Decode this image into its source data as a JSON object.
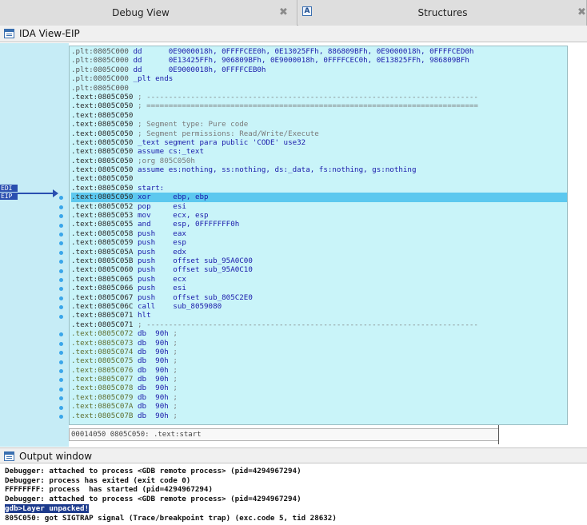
{
  "tabs": [
    {
      "label": "Debug View"
    },
    {
      "label": "Structures"
    }
  ],
  "tab_struct_icon": "A",
  "ida_view": {
    "title": "IDA View-EIP"
  },
  "registers": [
    {
      "name": "EDI"
    },
    {
      "name": "EIP"
    }
  ],
  "listing": [
    {
      "addr": ".plt:0805C000",
      "seg": "plt",
      "mnem": "dd",
      "ops": "0E9000018h, 0FFFFCEE0h, 0E13025FFh, 886809BFh, 0E9000018h, 0FFFFCED0h",
      "cmt": ""
    },
    {
      "addr": ".plt:0805C000",
      "seg": "plt",
      "mnem": "dd",
      "ops": "0E13425FFh, 906809BFh, 0E9000018h, 0FFFFCEC0h, 0E13825FFh, 986809BFh",
      "cmt": ""
    },
    {
      "addr": ".plt:0805C000",
      "seg": "plt",
      "mnem": "dd",
      "ops": "0E9000018h, 0FFFFCEB0h",
      "cmt": ""
    },
    {
      "addr": ".plt:0805C000",
      "seg": "plt",
      "mnem": "_plt ends",
      "ops": "",
      "cmt": ""
    },
    {
      "addr": ".plt:0805C000",
      "seg": "plt",
      "mnem": "",
      "ops": "",
      "cmt": ""
    },
    {
      "addr": ".text:0805C050",
      "seg": "text",
      "mnem": "",
      "ops": "",
      "cmt": "; ---------------------------------------------------------------------------"
    },
    {
      "addr": ".text:0805C050",
      "seg": "text",
      "mnem": "",
      "ops": "",
      "cmt": "; ==========================================================================="
    },
    {
      "addr": ".text:0805C050",
      "seg": "text",
      "mnem": "",
      "ops": "",
      "cmt": ""
    },
    {
      "addr": ".text:0805C050",
      "seg": "text",
      "mnem": "",
      "ops": "",
      "cmt": "; Segment type: Pure code"
    },
    {
      "addr": ".text:0805C050",
      "seg": "text",
      "mnem": "",
      "ops": "",
      "cmt": "; Segment permissions: Read/Write/Execute"
    },
    {
      "addr": ".text:0805C050",
      "seg": "text",
      "mnem": "_text segment para public 'CODE' use32",
      "ops": "",
      "cmt": ""
    },
    {
      "addr": ".text:0805C050",
      "seg": "text",
      "mnem": "assume cs:_text",
      "ops": "",
      "cmt": ""
    },
    {
      "addr": ".text:0805C050",
      "seg": "text",
      "mnem": "",
      "ops": "",
      "cmt": ";org 805C050h"
    },
    {
      "addr": ".text:0805C050",
      "seg": "text",
      "mnem": "assume es:nothing, ss:nothing, ds:_data, fs:nothing, gs:nothing",
      "ops": "",
      "cmt": ""
    },
    {
      "addr": ".text:0805C050",
      "seg": "text",
      "mnem": "",
      "ops": "",
      "cmt": ""
    },
    {
      "addr": ".text:0805C050",
      "seg": "text",
      "mnem": "start:",
      "ops": "",
      "cmt": ""
    },
    {
      "addr": ".text:0805C050",
      "seg": "text",
      "mnem": "xor",
      "ops": "ebp, ebp",
      "cmt": "",
      "highlight": true
    },
    {
      "addr": ".text:0805C052",
      "seg": "text",
      "mnem": "pop",
      "ops": "esi",
      "cmt": ""
    },
    {
      "addr": ".text:0805C053",
      "seg": "text",
      "mnem": "mov",
      "ops": "ecx, esp",
      "cmt": ""
    },
    {
      "addr": ".text:0805C055",
      "seg": "text",
      "mnem": "and",
      "ops": "esp, 0FFFFFFF0h",
      "cmt": ""
    },
    {
      "addr": ".text:0805C058",
      "seg": "text",
      "mnem": "push",
      "ops": "eax",
      "cmt": ""
    },
    {
      "addr": ".text:0805C059",
      "seg": "text",
      "mnem": "push",
      "ops": "esp",
      "cmt": ""
    },
    {
      "addr": ".text:0805C05A",
      "seg": "text",
      "mnem": "push",
      "ops": "edx",
      "cmt": ""
    },
    {
      "addr": ".text:0805C05B",
      "seg": "text",
      "mnem": "push",
      "ops": "offset sub_95A0C00",
      "cmt": ""
    },
    {
      "addr": ".text:0805C060",
      "seg": "text",
      "mnem": "push",
      "ops": "offset sub_95A0C10",
      "cmt": ""
    },
    {
      "addr": ".text:0805C065",
      "seg": "text",
      "mnem": "push",
      "ops": "ecx",
      "cmt": ""
    },
    {
      "addr": ".text:0805C066",
      "seg": "text",
      "mnem": "push",
      "ops": "esi",
      "cmt": ""
    },
    {
      "addr": ".text:0805C067",
      "seg": "text",
      "mnem": "push",
      "ops": "offset sub_805C2E0",
      "cmt": ""
    },
    {
      "addr": ".text:0805C06C",
      "seg": "text",
      "mnem": "call",
      "ops": "sub_8059080",
      "cmt": ""
    },
    {
      "addr": ".text:0805C071",
      "seg": "text",
      "mnem": "hlt",
      "ops": "",
      "cmt": ""
    },
    {
      "addr": ".text:0805C071",
      "seg": "text",
      "mnem": "",
      "ops": "",
      "cmt": "; ---------------------------------------------------------------------------"
    },
    {
      "addr": ".text:0805C072",
      "seg": "data",
      "mnem": "db",
      "ops": "90h",
      "cmt": ";"
    },
    {
      "addr": ".text:0805C073",
      "seg": "data",
      "mnem": "db",
      "ops": "90h",
      "cmt": ";"
    },
    {
      "addr": ".text:0805C074",
      "seg": "data",
      "mnem": "db",
      "ops": "90h",
      "cmt": ";"
    },
    {
      "addr": ".text:0805C075",
      "seg": "data",
      "mnem": "db",
      "ops": "90h",
      "cmt": ";"
    },
    {
      "addr": ".text:0805C076",
      "seg": "data",
      "mnem": "db",
      "ops": "90h",
      "cmt": ";"
    },
    {
      "addr": ".text:0805C077",
      "seg": "data",
      "mnem": "db",
      "ops": "90h",
      "cmt": ";"
    },
    {
      "addr": ".text:0805C078",
      "seg": "data",
      "mnem": "db",
      "ops": "90h",
      "cmt": ";"
    },
    {
      "addr": ".text:0805C079",
      "seg": "data",
      "mnem": "db",
      "ops": "90h",
      "cmt": ";"
    },
    {
      "addr": ".text:0805C07A",
      "seg": "data",
      "mnem": "db",
      "ops": "90h",
      "cmt": ";"
    },
    {
      "addr": ".text:0805C07B",
      "seg": "data",
      "mnem": "db",
      "ops": "90h",
      "cmt": ";"
    }
  ],
  "status_bar": "00014050 0805C050: .text:start",
  "output_window": {
    "title": "Output window",
    "lines": [
      {
        "text": "Debugger: attached to process <GDB remote process> (pid=4294967294)"
      },
      {
        "text": "Debugger: process has exited (exit code 0)"
      },
      {
        "text": "FFFFFFFF: process  has started (pid=4294967294)"
      },
      {
        "text": "Debugger: attached to process <GDB remote process> (pid=4294967294)"
      },
      {
        "text": "gdb>Layer unpacked!",
        "highlight": true
      },
      {
        "text": "805C050: got SIGTRAP signal (Trace/breakpoint trap) (exc.code 5, tid 28632)"
      }
    ]
  },
  "icons": [
    "close-icon",
    "structures-icon",
    "ida-view-icon",
    "output-window-icon",
    "eip-arrow-icon",
    "breakpoint-dot-icon"
  ],
  "colors": {
    "listing_bg": "#c9f4f9",
    "gutter_bg": "#c6ecf6",
    "current_line": "#5cc8ef",
    "instruction_blue": "#1a1aaa",
    "register_tag": "#2a4fb0"
  }
}
